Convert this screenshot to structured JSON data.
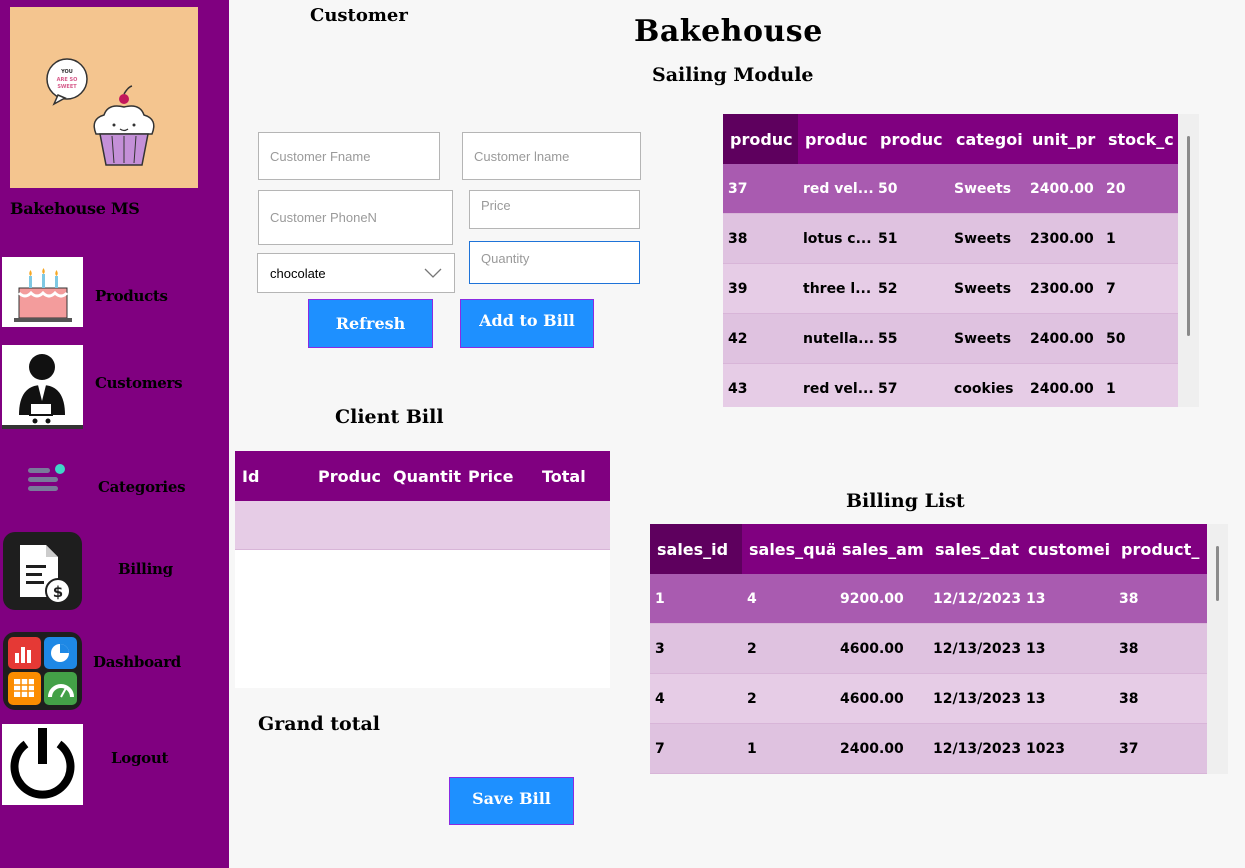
{
  "sidebar": {
    "brand": "Bakehouse MS",
    "logo_text": [
      "YOU",
      "ARE SO",
      "SWEET"
    ],
    "items": [
      {
        "label": "Products"
      },
      {
        "label": "Customers"
      },
      {
        "label": "Categories"
      },
      {
        "label": "Billing"
      },
      {
        "label": "Dashboard"
      },
      {
        "label": "Logout"
      }
    ]
  },
  "header": {
    "section": "Customer",
    "title": "Bakehouse",
    "subtitle": "Sailing Module"
  },
  "form": {
    "fname_placeholder": "Customer Fname",
    "lname_placeholder": "Customer lname",
    "phone_placeholder": "Customer PhoneN",
    "price_placeholder": "Price",
    "quantity_placeholder": "Quantity",
    "category_selected": "chocolate",
    "refresh_label": "Refresh",
    "add_label": "Add to Bill"
  },
  "products_grid": {
    "columns": [
      "produc",
      "produc",
      "produc",
      "categoi",
      "unit_pr",
      "stock_c"
    ],
    "rows": [
      [
        "37",
        "red vel...",
        "50",
        "Sweets",
        "2400.00",
        "20"
      ],
      [
        "38",
        "lotus c...",
        "51",
        "Sweets",
        "2300.00",
        "1"
      ],
      [
        "39",
        "three l...",
        "52",
        "Sweets",
        "2300.00",
        "7"
      ],
      [
        "42",
        "nutella...",
        "55",
        "Sweets",
        "2400.00",
        "50"
      ],
      [
        "43",
        "red vel...",
        "57",
        "cookies",
        "2400.00",
        "1"
      ]
    ]
  },
  "client_bill": {
    "title": "Client Bill",
    "columns": [
      "Id",
      "Produc",
      "Quantit",
      "Price",
      "Total"
    ]
  },
  "billing_list": {
    "title": "Billing List",
    "columns": [
      "sales_id",
      "sales_quä",
      "sales_am",
      "sales_dat",
      "customei",
      "product_"
    ],
    "rows": [
      [
        "1",
        "4",
        "9200.00",
        "12/12/2023",
        "13",
        "38"
      ],
      [
        "3",
        "2",
        "4600.00",
        "12/13/2023",
        "13",
        "38"
      ],
      [
        "4",
        "2",
        "4600.00",
        "12/13/2023",
        "13",
        "38"
      ],
      [
        "7",
        "1",
        "2400.00",
        "12/13/2023",
        "1023",
        "37"
      ]
    ]
  },
  "footer": {
    "grand_total_label": "Grand total",
    "save_label": "Save Bill"
  },
  "colors": {
    "sidebar": "#800080",
    "header_row": "#800080",
    "selected_row": "#a95bb0",
    "row": "#dfc2e0",
    "button": "#1e90ff"
  }
}
